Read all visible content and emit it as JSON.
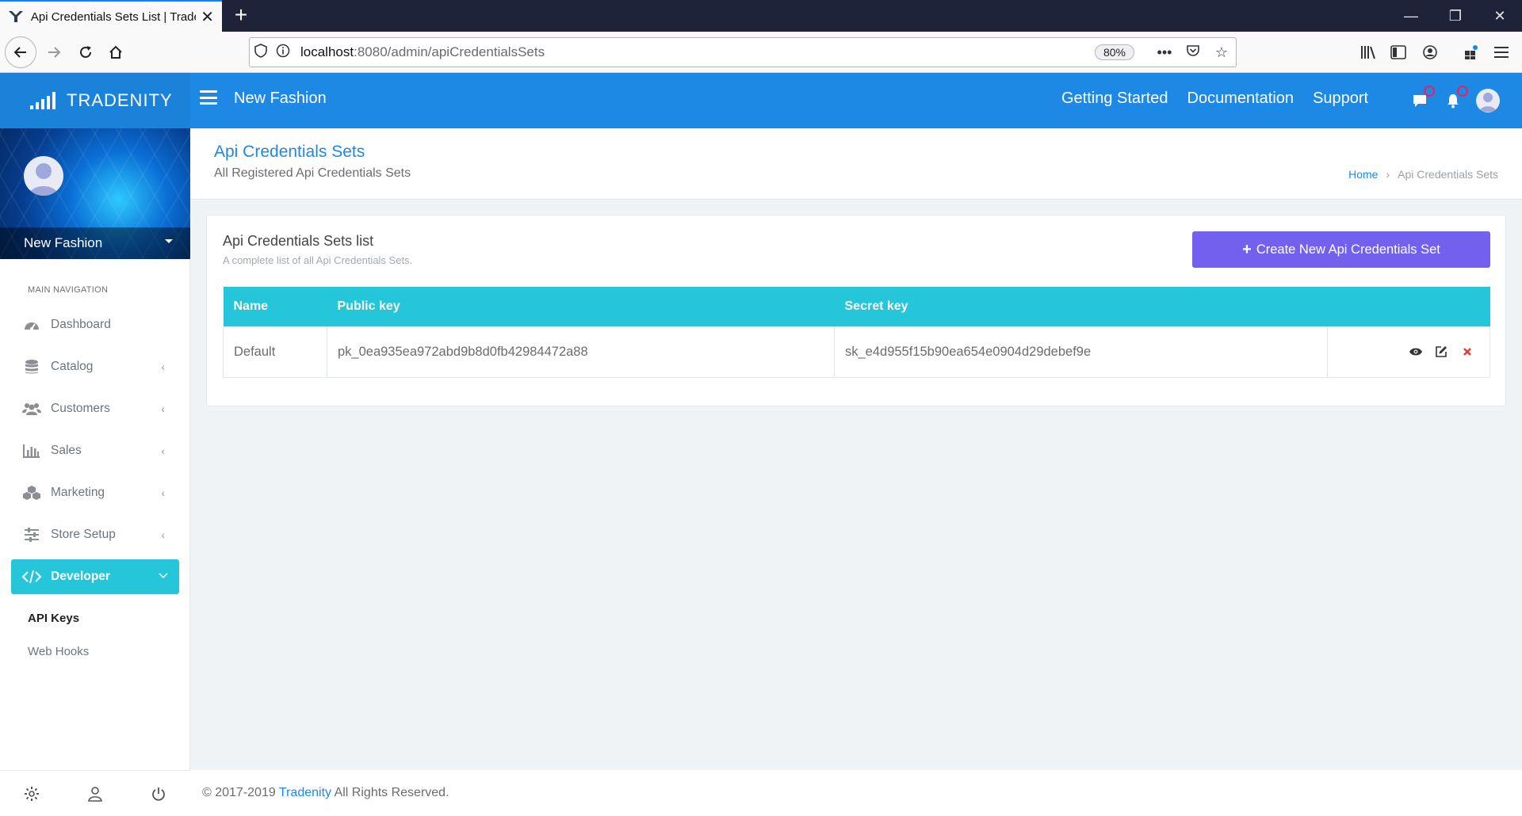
{
  "browser": {
    "tab_title": "Api Credentials Sets List | Trade",
    "url_host": "localhost",
    "url_path": ":8080/admin/apiCredentialsSets",
    "zoom": "80%"
  },
  "brand": {
    "name": "TRADENITY"
  },
  "topbar": {
    "store_name": "New Fashion",
    "links": [
      "Getting Started",
      "Documentation",
      "Support"
    ]
  },
  "sidebar": {
    "profile_name": "New Fashion",
    "nav_label": "MAIN NAVIGATION",
    "items": [
      {
        "label": "Dashboard",
        "icon": "dashboard-icon"
      },
      {
        "label": "Catalog",
        "icon": "database-icon"
      },
      {
        "label": "Customers",
        "icon": "users-icon"
      },
      {
        "label": "Sales",
        "icon": "bar-chart-icon"
      },
      {
        "label": "Marketing",
        "icon": "cubes-icon"
      },
      {
        "label": "Store Setup",
        "icon": "sliders-icon"
      },
      {
        "label": "Developer",
        "icon": "code-icon"
      }
    ],
    "subitems": [
      "API Keys",
      "Web Hooks"
    ]
  },
  "page": {
    "title": "Api Credentials Sets",
    "subtitle": "All Registered Api Credentials Sets",
    "breadcrumb": {
      "home": "Home",
      "current": "Api Credentials Sets"
    }
  },
  "card": {
    "title": "Api Credentials Sets list",
    "subtitle": "A complete list of all Api Credentials Sets.",
    "create_button": "Create New Api Credentials Set",
    "columns": [
      "Name",
      "Public key",
      "Secret key"
    ],
    "rows": [
      {
        "name": "Default",
        "public_key": "pk_0ea935ea972abd9b8d0fb42984472a88",
        "secret_key": "sk_e4d955f15b90ea654e0904d29debef9e"
      }
    ]
  },
  "footer": {
    "copyright": "© 2017-2019",
    "brand_link": "Tradenity",
    "rights": "All Rights Reserved."
  },
  "colors": {
    "primary": "#1e88e5",
    "accent": "#26c6da",
    "button": "#7460ee",
    "delete": "#e53935"
  }
}
